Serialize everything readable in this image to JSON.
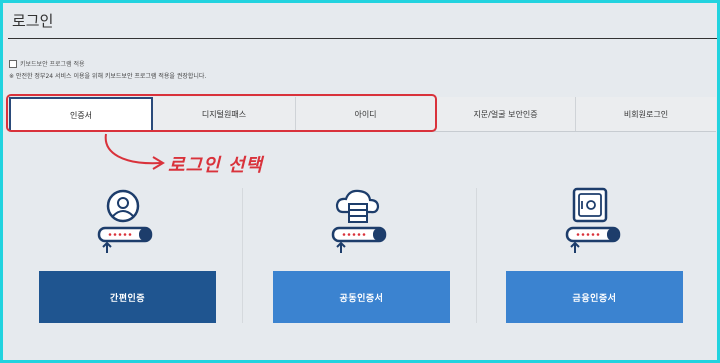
{
  "page": {
    "title": "로그인"
  },
  "keyboard_security": {
    "checkbox_label": "키보드보안 프로그램 적용",
    "note": "※ 안전한 정부24 서비스 이용을 위해 키보드보안 프로그램 적용을 권장합니다."
  },
  "tabs": [
    {
      "label": "인증서",
      "active": true
    },
    {
      "label": "디지털원패스",
      "active": false
    },
    {
      "label": "아이디",
      "active": false
    },
    {
      "label": "지문/얼굴 보안인증",
      "active": false
    },
    {
      "label": "비회원로그인",
      "active": false
    }
  ],
  "annotation": {
    "text": "로그인 선택",
    "color": "#d9323b"
  },
  "methods": [
    {
      "label": "간편인증",
      "icon": "person-id-icon",
      "color": "#1f5590"
    },
    {
      "label": "공동인증서",
      "icon": "cloud-server-icon",
      "color": "#3b83d0"
    },
    {
      "label": "금융인증서",
      "icon": "safe-box-icon",
      "color": "#3b83d0"
    }
  ],
  "colors": {
    "accent_dark": "#1f5590",
    "accent": "#3b83d0",
    "highlight": "#d9323b",
    "frame_border": "#22d3df"
  }
}
